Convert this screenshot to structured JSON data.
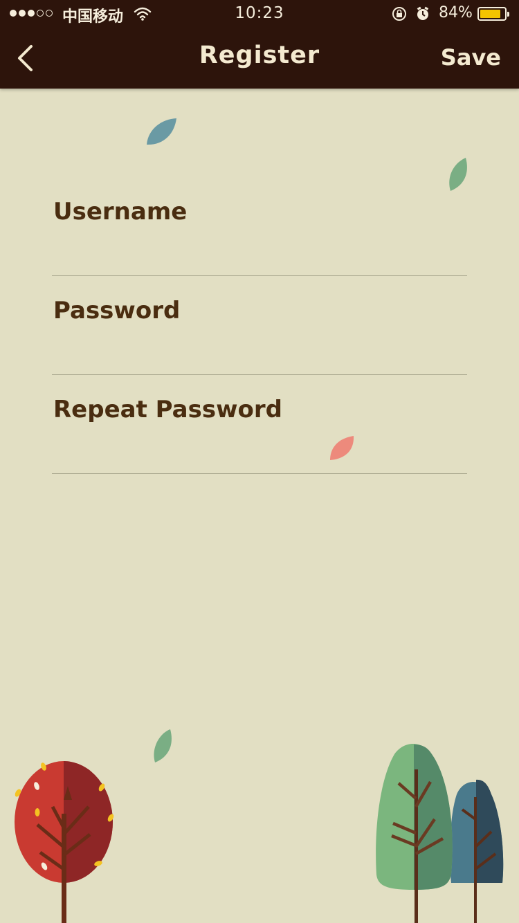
{
  "status_bar": {
    "carrier": "中国移动",
    "time": "10:23",
    "battery_percent": "84%",
    "battery_level": 0.84,
    "signal_bars": 3,
    "signal_max": 5
  },
  "nav": {
    "back_icon": "chevron-left-icon",
    "title": "Register",
    "save_label": "Save"
  },
  "form": {
    "fields": [
      {
        "label": "Username",
        "value": ""
      },
      {
        "label": "Password",
        "value": ""
      },
      {
        "label": "Repeat Password",
        "value": ""
      }
    ]
  },
  "colors": {
    "nav_background": "#2d140b",
    "page_background": "#e2dfc3",
    "label_text": "#4a2d10",
    "nav_text": "#f4ead0",
    "battery_fill": "#f4c400"
  }
}
